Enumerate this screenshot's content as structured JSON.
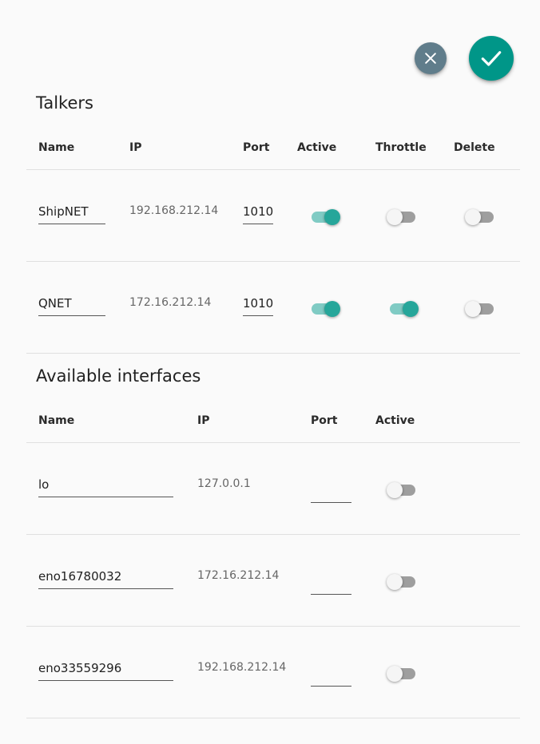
{
  "actions": {
    "cancel_icon": "close-icon",
    "confirm_icon": "check-icon"
  },
  "talkers": {
    "title": "Talkers",
    "headers": {
      "name": "Name",
      "ip": "IP",
      "port": "Port",
      "active": "Active",
      "throttle": "Throttle",
      "delete": "Delete"
    },
    "rows": [
      {
        "name": "ShipNET",
        "ip": "192.168.212.14",
        "port": "1010",
        "active": true,
        "throttle": false,
        "delete": false
      },
      {
        "name": "QNET",
        "ip": "172.16.212.14",
        "port": "1010",
        "active": true,
        "throttle": true,
        "delete": false
      }
    ]
  },
  "interfaces": {
    "title": "Available interfaces",
    "headers": {
      "name": "Name",
      "ip": "IP",
      "port": "Port",
      "active": "Active"
    },
    "rows": [
      {
        "name": "lo",
        "ip": "127.0.0.1",
        "port": "",
        "active": false
      },
      {
        "name": "eno16780032",
        "ip": "172.16.212.14",
        "port": "",
        "active": false
      },
      {
        "name": "eno33559296",
        "ip": "192.168.212.14",
        "port": "",
        "active": false
      }
    ]
  },
  "colors": {
    "accent": "#009688",
    "cancel": "#607d8b",
    "toggle_on_thumb": "#26a69a",
    "toggle_on_track": "#80cbc4"
  }
}
